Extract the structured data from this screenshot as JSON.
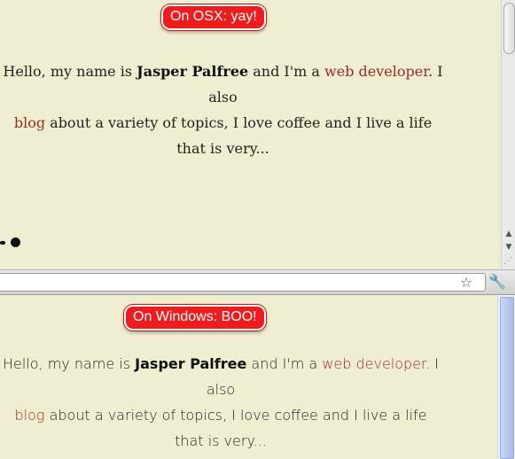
{
  "osx": {
    "badge": "On OSX: yay!",
    "bio": {
      "t1": "Hello, my name is ",
      "name": "Jasper Palfree",
      "t2": " and I'm a ",
      "link1": "web developer",
      "t3": ". I also ",
      "link2": "blog",
      "t4": " about a variety of topics, I love coffee and I live a life that is very..."
    }
  },
  "windows": {
    "badge": "On Windows: BOO!",
    "bio": {
      "t1": "Hello, my name is ",
      "name": "Jasper Palfree",
      "t2": " and I'm a ",
      "link1": "web developer",
      "t3": ". I also ",
      "link2": "blog",
      "t4": " about a variety of topics, I love coffee and I live a life that is very..."
    }
  },
  "toolbar": {
    "star_icon": "star-icon",
    "wrench_icon": "wrench-icon"
  },
  "colors": {
    "background": "#f0eed0",
    "badge": "#ee1c1c",
    "link": "#9b2a2a"
  }
}
